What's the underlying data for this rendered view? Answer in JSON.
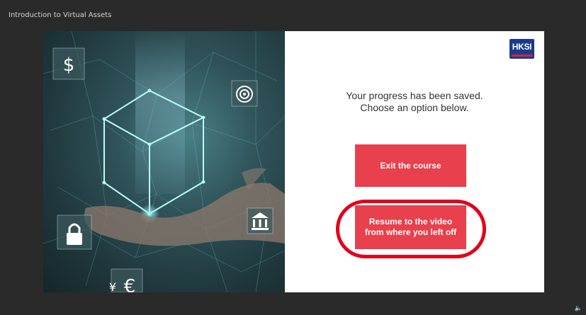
{
  "window": {
    "title": "Introduction to Virtual Assets"
  },
  "logo": {
    "text": "HKSI"
  },
  "panel": {
    "message_line1": "Your progress has been saved.",
    "message_line2": "Choose an option below."
  },
  "buttons": {
    "exit_label": "Exit the course",
    "resume_line1": "Resume to the video",
    "resume_line2": "from where you left off"
  },
  "colors": {
    "background": "#2a2a2a",
    "button": "#e8404d",
    "highlight": "#e2001a",
    "logo_blue": "#1c3a8c",
    "logo_red": "#d8262f"
  },
  "icons": [
    "dollar-icon",
    "target-icon",
    "lock-icon",
    "bank-icon",
    "euro-icon",
    "yen-icon",
    "speaker-icon"
  ]
}
